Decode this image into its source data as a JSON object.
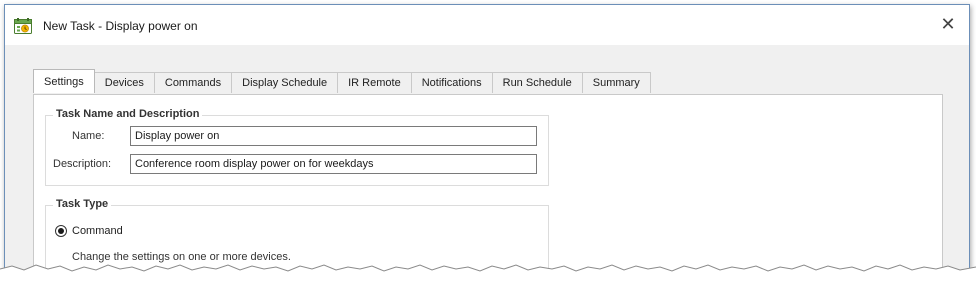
{
  "window": {
    "title": "New Task - Display power on",
    "app_icon": "task-calendar-icon",
    "close_glyph": "✕"
  },
  "tabs": [
    {
      "label": "Settings",
      "active": true
    },
    {
      "label": "Devices",
      "active": false
    },
    {
      "label": "Commands",
      "active": false
    },
    {
      "label": "Display Schedule",
      "active": false
    },
    {
      "label": "IR Remote",
      "active": false
    },
    {
      "label": "Notifications",
      "active": false
    },
    {
      "label": "Run Schedule",
      "active": false
    },
    {
      "label": "Summary",
      "active": false
    }
  ],
  "task_name_group": {
    "title": "Task Name and Description",
    "name_label": "Name:",
    "name_value": "Display power on",
    "description_label": "Description:",
    "description_value": "Conference room display power on for weekdays"
  },
  "task_type_group": {
    "title": "Task Type",
    "command_option": {
      "label": "Command",
      "selected": true,
      "description": "Change the settings on one or more devices."
    }
  },
  "colors": {
    "dialog_background": "#f0f0f0",
    "panel_background": "#ffffff",
    "window_border": "#6c8fb8"
  }
}
